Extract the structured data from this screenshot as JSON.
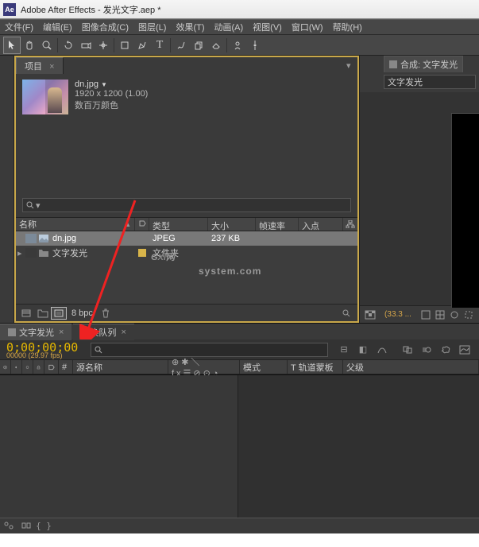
{
  "title": "Adobe After Effects - 发光文字.aep *",
  "menu": [
    "文件(F)",
    "编辑(E)",
    "图像合成(C)",
    "图层(L)",
    "效果(T)",
    "动画(A)",
    "视图(V)",
    "窗口(W)",
    "帮助(H)"
  ],
  "project": {
    "tab": "项目",
    "file": {
      "name": "dn.jpg",
      "dims": "1920 x 1200 (1.00)",
      "colors": "数百万颜色"
    },
    "search_placeholder": "",
    "columns": {
      "name": "名称",
      "type": "类型",
      "size": "大小",
      "rate": "帧速率",
      "in": "入点"
    },
    "rows": [
      {
        "name": "dn.jpg",
        "type": "JPEG",
        "size": "237 KB",
        "icon": "image",
        "swatch": "#7b8a99",
        "selected": true
      },
      {
        "name": "文字发光",
        "type": "文件夹",
        "size": "",
        "icon": "folder",
        "swatch": "#d8b44a",
        "selected": false,
        "twirl": true
      }
    ],
    "bpc": "8 bpc"
  },
  "composition": {
    "tab": "合成: 文字发光",
    "dropdown": "文字发光",
    "zoom": "(33.3 ..."
  },
  "timeline": {
    "tabs": [
      "文字发光",
      "渲染队列"
    ],
    "timecode": "0;00;00;00",
    "frames": "00000 (29.97 fps)",
    "columns": {
      "source": "源名称",
      "mode": "模式",
      "track": "T 轨道蒙板",
      "parent": "父级"
    }
  },
  "watermark": {
    "main_g": "G",
    "main_xi": "XI",
    "cn": "网",
    "sub": "system.com"
  }
}
